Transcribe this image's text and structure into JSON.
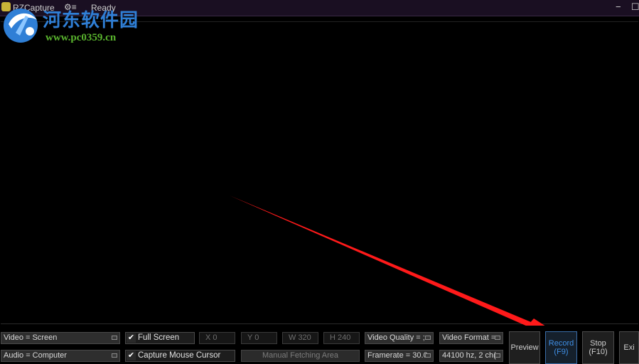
{
  "titlebar": {
    "app_name": "RZCapture",
    "menu_icon": "menu-icon",
    "status": "Ready",
    "minimize_icon": "minimize-icon",
    "maximize_icon": "maximize-icon"
  },
  "watermark": {
    "site_name": "河东软件园",
    "url": "www.pc0359.cn"
  },
  "controls": {
    "video_source": "Video = Screen",
    "audio_source": "Audio = Computer",
    "full_screen_label": "Full Screen",
    "full_screen_checked": true,
    "capture_cursor_label": "Capture Mouse Cursor",
    "capture_cursor_checked": true,
    "x_field": "X 0",
    "y_field": "Y 0",
    "w_field": "W 320",
    "h_field": "H 240",
    "manual_fetch_label": "Manual Fetching Area",
    "video_quality": "Video Quality = ;",
    "framerate": "Framerate = 30.0",
    "video_format": "Video Format =",
    "audio_format": "44100 hz, 2 ch(",
    "preview_label": "Preview",
    "record_label": "Record",
    "record_hotkey": "(F9)",
    "stop_label": "Stop",
    "stop_hotkey": "(F10)",
    "exit_label": "Exi"
  },
  "colors": {
    "background": "#000000",
    "titlebar": "#1a0f22",
    "record_accent": "#3f8fe6",
    "annotation_arrow": "#ff1a1a"
  }
}
